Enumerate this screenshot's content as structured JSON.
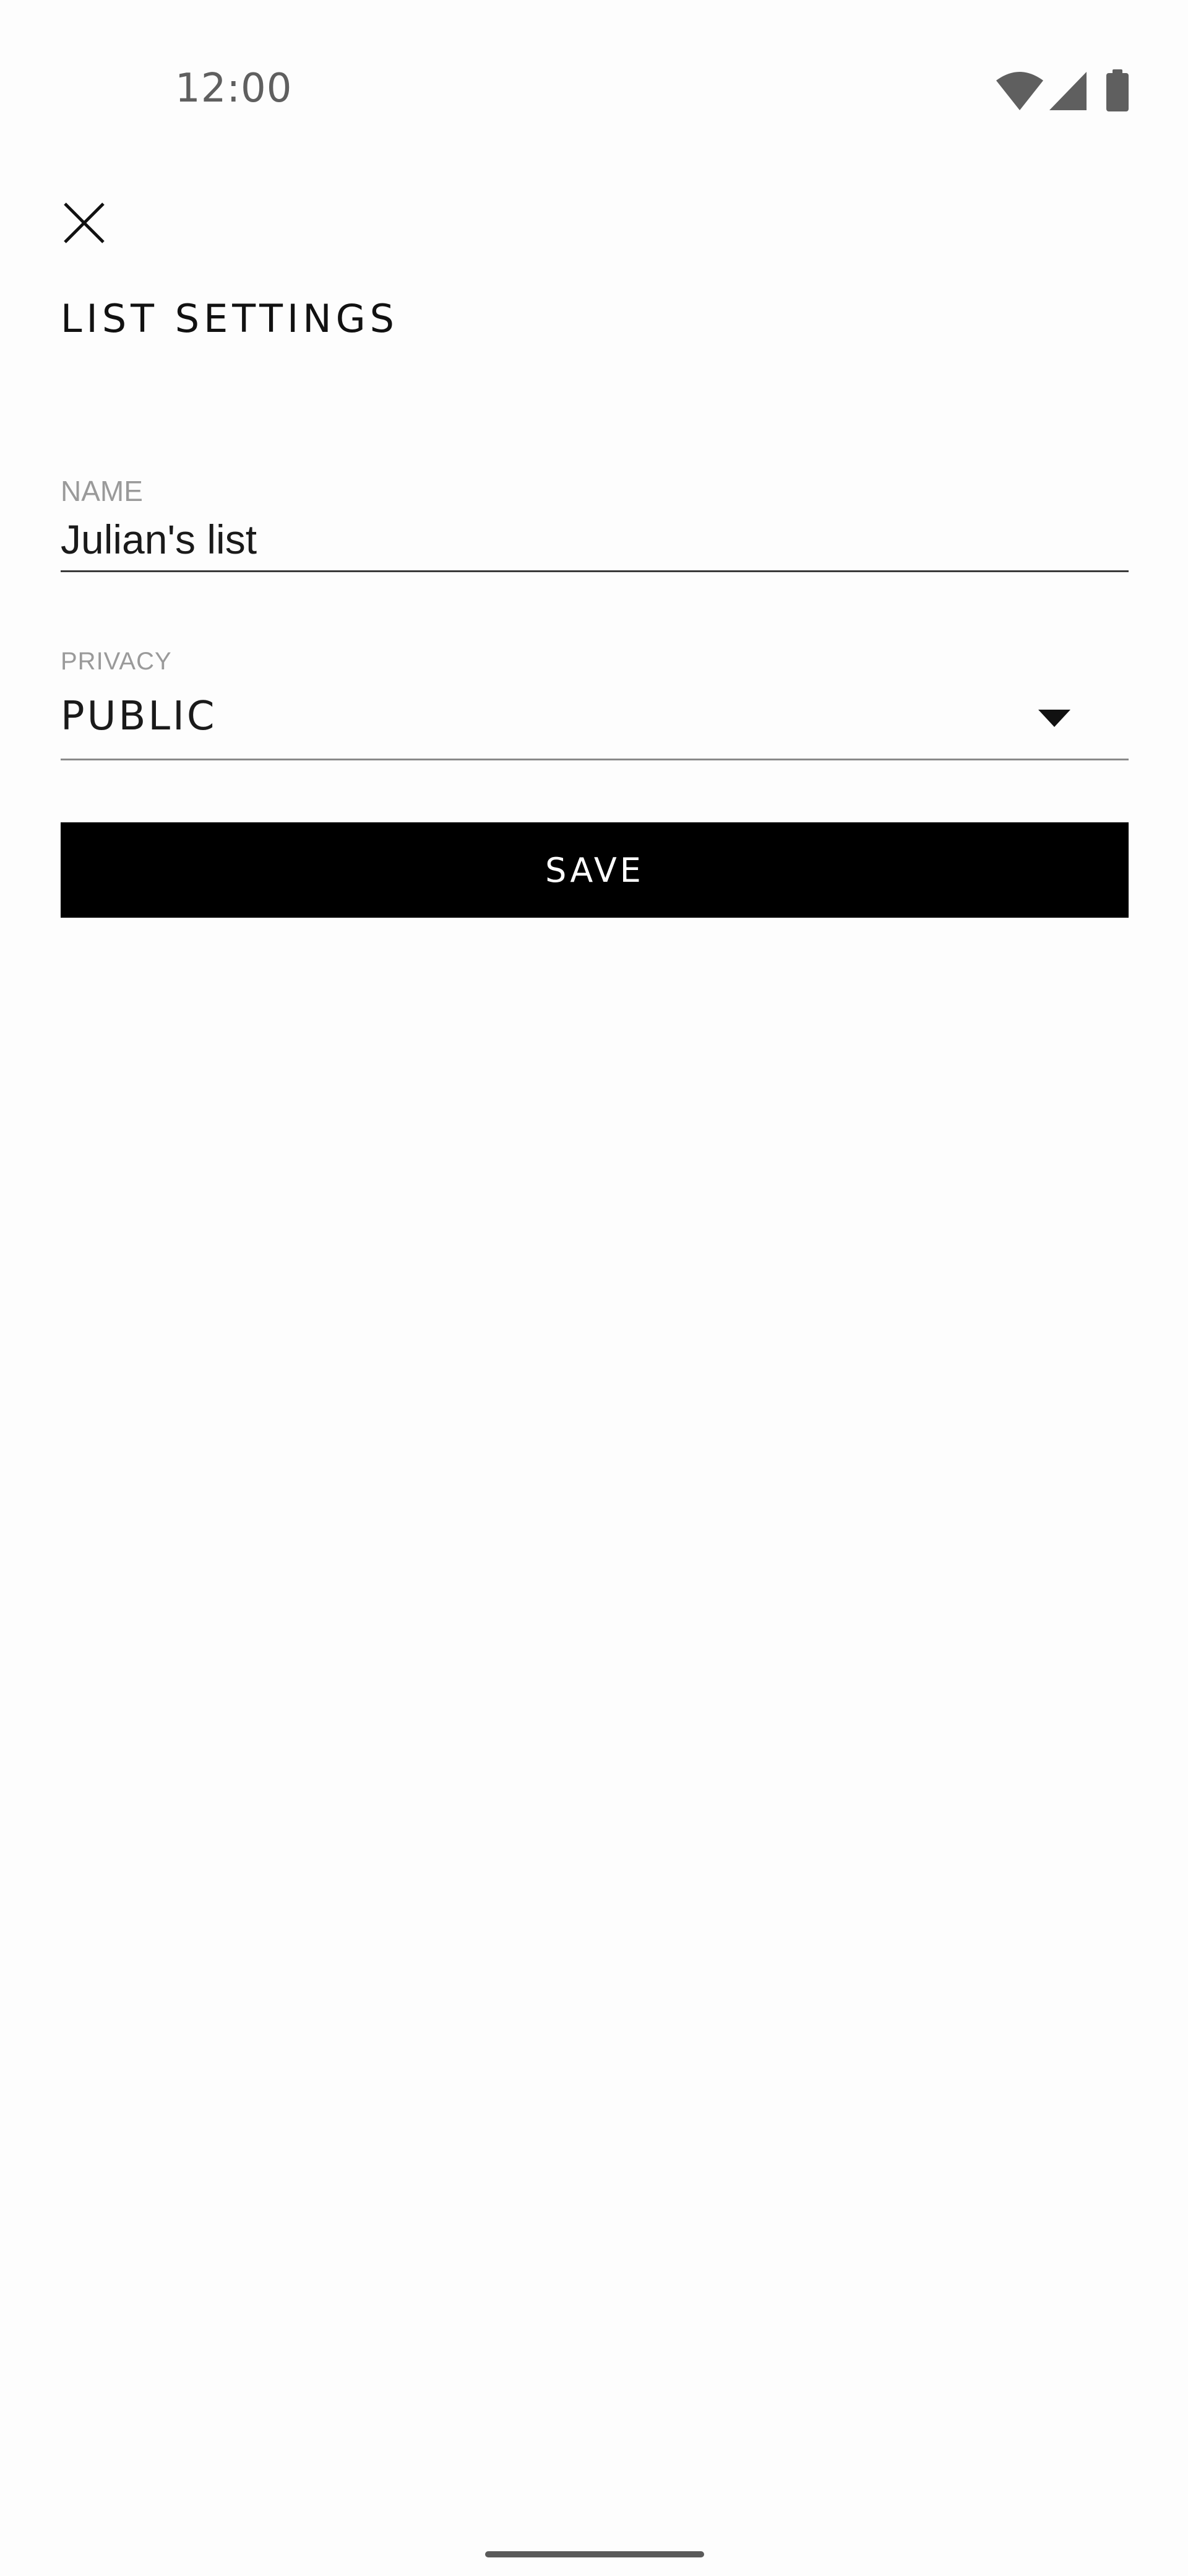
{
  "status_bar": {
    "time": "12:00",
    "icons": [
      "wifi-icon",
      "cellular-signal-icon",
      "battery-icon"
    ]
  },
  "header": {
    "close_icon": "close-icon",
    "title": "LIST SETTINGS"
  },
  "form": {
    "name": {
      "label": "NAME",
      "value": "Julian's list"
    },
    "privacy": {
      "label": "PRIVACY",
      "selected": "PUBLIC",
      "icon": "dropdown-arrow-icon"
    },
    "save_label": "SAVE"
  },
  "colors": {
    "background": "#fdfdfd",
    "primary_button": "#000000",
    "label_gray": "#9a9a9a",
    "text": "#1a1a1a"
  }
}
